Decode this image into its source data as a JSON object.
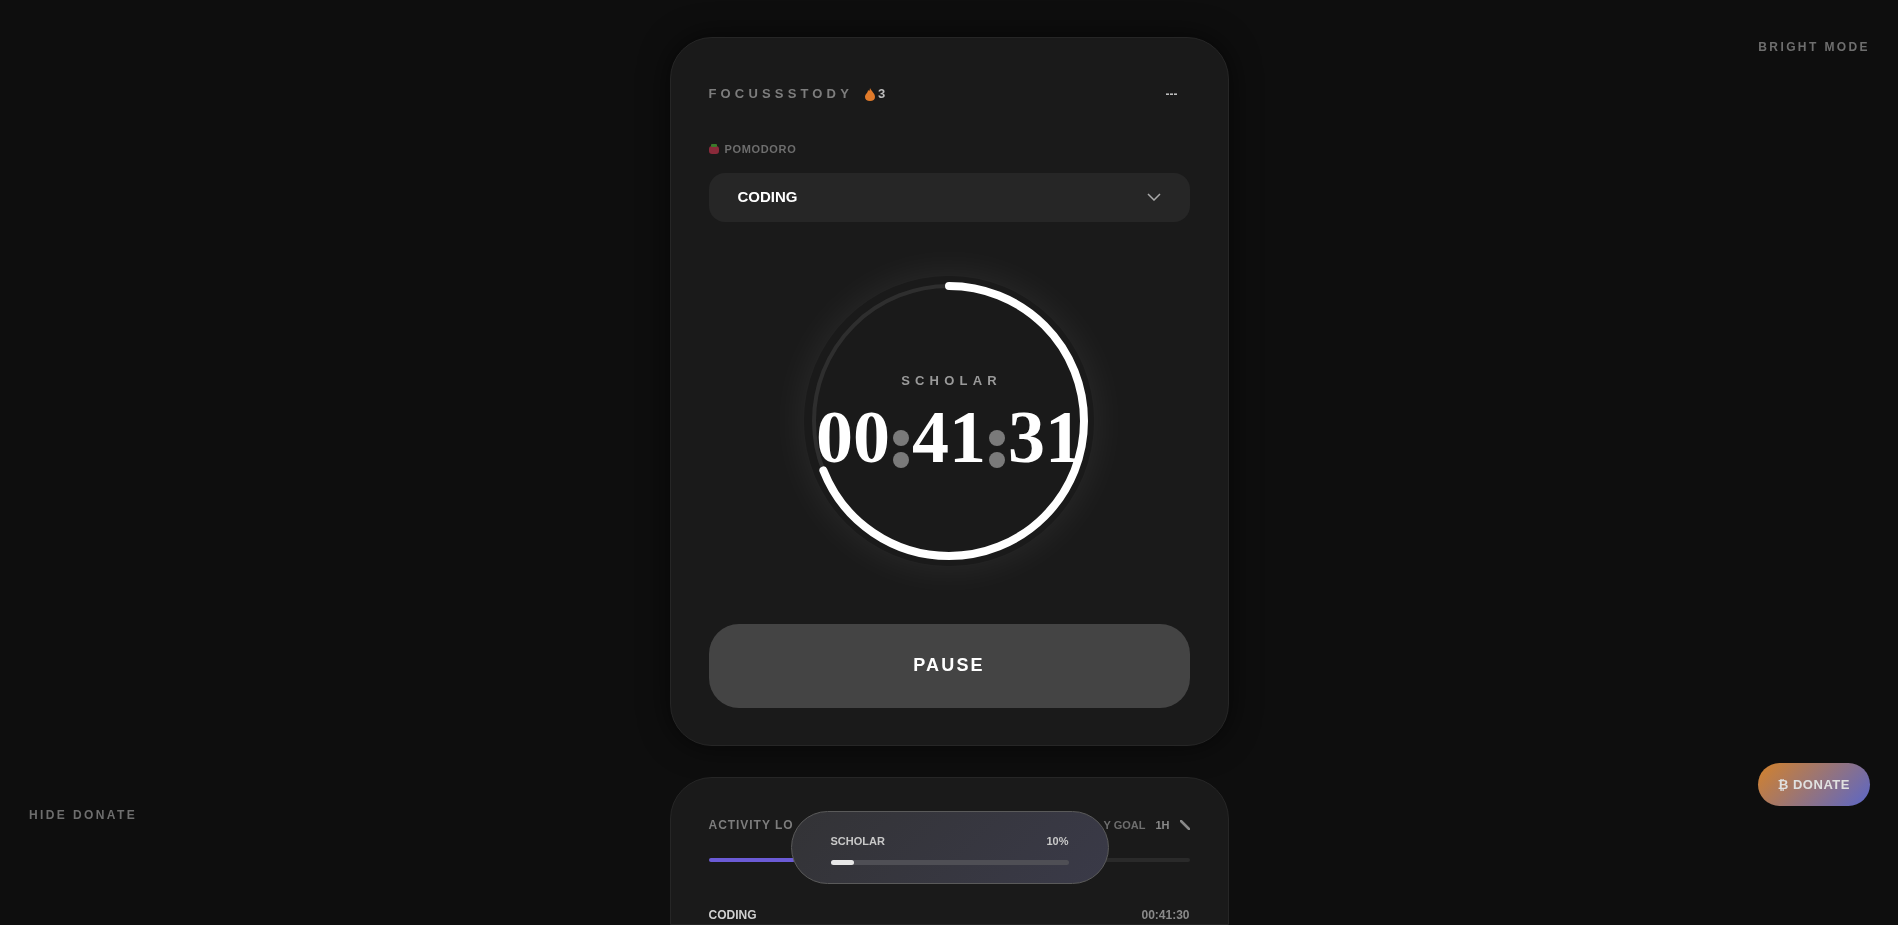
{
  "side": {
    "hide_donate": "HIDE DONATE",
    "bright_mode": "BRIGHT MODE",
    "donate": "₿ DONATE"
  },
  "timer_card": {
    "app_name": "FOCUSSSTODY",
    "streak": "3",
    "menu": "---",
    "mode_label": "POMODORO",
    "task": "CODING",
    "rank": "SCHOLAR",
    "hours": "00",
    "minutes": "41",
    "seconds": "31",
    "level": 0.69,
    "action": "PAUSE"
  },
  "activity_card": {
    "title": "ACTIVITY LO",
    "goal_label": "Y GOAL",
    "goal_value": "1H",
    "level": 0.18,
    "entries": [
      {
        "task": "CODING",
        "time": "00:41:30"
      }
    ]
  },
  "rank_popup": {
    "rank": "SCHOLAR",
    "percent": "10%",
    "level": 0.1
  }
}
